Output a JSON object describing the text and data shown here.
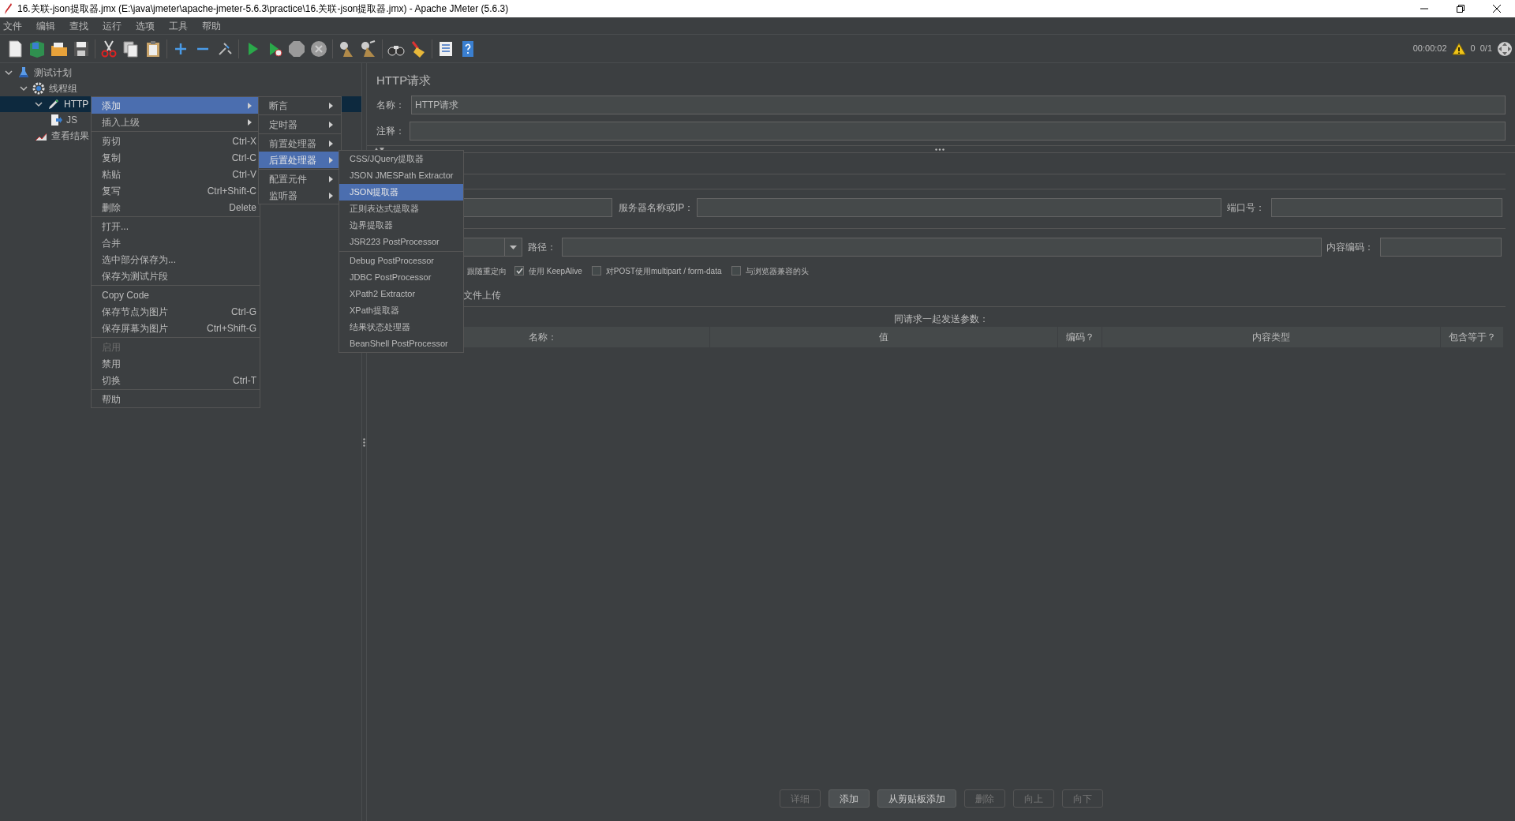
{
  "window": {
    "title": "16.关联-json提取器.jmx (E:\\java\\jmeter\\apache-jmeter-5.6.3\\practice\\16.关联-json提取器.jmx) - Apache JMeter (5.6.3)"
  },
  "menu_bar": [
    "文件",
    "编辑",
    "查找",
    "运行",
    "选项",
    "工具",
    "帮助"
  ],
  "status": {
    "elapsed": "00:00:02",
    "warnings": "0",
    "threads": "0/1"
  },
  "tree": [
    {
      "label": "测试计划",
      "kind": "test_plan",
      "selected": false,
      "expanded": true,
      "children": [
        {
          "label": "线程组",
          "kind": "thread_group",
          "selected": false,
          "expanded": true,
          "children": [
            {
              "label": "HTTP",
              "kind": "sampler",
              "selected": true,
              "expanded": true,
              "children": [
                {
                  "label": "JS",
                  "kind": "extractor",
                  "selected": false
                }
              ]
            },
            {
              "label": "查看结果",
              "kind": "listener",
              "selected": false
            }
          ]
        }
      ]
    }
  ],
  "context_menu": {
    "groups": [
      [
        {
          "label": "添加",
          "has_submenu": true,
          "selected": true,
          "disabled": false
        },
        {
          "label": "插入上级",
          "has_submenu": true,
          "selected": false,
          "disabled": false
        }
      ],
      [
        {
          "label": "剪切",
          "shortcut": "Ctrl-X",
          "has_submenu": false,
          "selected": false,
          "disabled": false
        },
        {
          "label": "复制",
          "shortcut": "Ctrl-C",
          "has_submenu": false,
          "selected": false,
          "disabled": false
        },
        {
          "label": "粘贴",
          "shortcut": "Ctrl-V",
          "has_submenu": false,
          "selected": false,
          "disabled": false
        },
        {
          "label": "复写",
          "shortcut": "Ctrl+Shift-C",
          "has_submenu": false,
          "selected": false,
          "disabled": false
        },
        {
          "label": "删除",
          "shortcut": "Delete",
          "has_submenu": false,
          "selected": false,
          "disabled": false
        }
      ],
      [
        {
          "label": "打开...",
          "has_submenu": false,
          "selected": false,
          "disabled": false
        },
        {
          "label": "合并",
          "has_submenu": false,
          "selected": false,
          "disabled": false
        },
        {
          "label": "选中部分保存为...",
          "has_submenu": false,
          "selected": false,
          "disabled": false
        },
        {
          "label": "保存为测试片段",
          "has_submenu": false,
          "selected": false,
          "disabled": false
        }
      ],
      [
        {
          "label": "Copy Code",
          "has_submenu": false,
          "selected": false,
          "disabled": false
        },
        {
          "label": "保存节点为图片",
          "shortcut": "Ctrl-G",
          "has_submenu": false,
          "selected": false,
          "disabled": false
        },
        {
          "label": "保存屏幕为图片",
          "shortcut": "Ctrl+Shift-G",
          "has_submenu": false,
          "selected": false,
          "disabled": false
        }
      ],
      [
        {
          "label": "启用",
          "has_submenu": false,
          "selected": false,
          "disabled": true
        },
        {
          "label": "禁用",
          "has_submenu": false,
          "selected": false,
          "disabled": false
        },
        {
          "label": "切换",
          "shortcut": "Ctrl-T",
          "has_submenu": false,
          "selected": false,
          "disabled": false
        }
      ],
      [
        {
          "label": "帮助",
          "has_submenu": false,
          "selected": false,
          "disabled": false
        }
      ]
    ]
  },
  "add_submenu": {
    "groups": [
      [
        {
          "label": "断言",
          "has_submenu": true,
          "selected": false
        }
      ],
      [
        {
          "label": "定时器",
          "has_submenu": true,
          "selected": false
        }
      ],
      [
        {
          "label": "前置处理器",
          "has_submenu": true,
          "selected": false
        },
        {
          "label": "后置处理器",
          "has_submenu": true,
          "selected": true
        }
      ],
      [
        {
          "label": "配置元件",
          "has_submenu": true,
          "selected": false
        },
        {
          "label": "监听器",
          "has_submenu": true,
          "selected": false
        }
      ]
    ]
  },
  "post_processor_submenu": {
    "groups": [
      [
        {
          "label": "CSS/JQuery提取器",
          "has_submenu": false,
          "selected": false
        },
        {
          "label": "JSON JMESPath Extractor",
          "has_submenu": false,
          "selected": false
        },
        {
          "label": "JSON提取器",
          "has_submenu": false,
          "selected": true
        },
        {
          "label": "正则表达式提取器",
          "has_submenu": false,
          "selected": false
        },
        {
          "label": "边界提取器",
          "has_submenu": false,
          "selected": false
        },
        {
          "label": "JSR223 PostProcessor",
          "has_submenu": false,
          "selected": false
        }
      ],
      [
        {
          "label": "Debug PostProcessor",
          "has_submenu": false,
          "selected": false
        },
        {
          "label": "JDBC PostProcessor",
          "has_submenu": false,
          "selected": false
        },
        {
          "label": "XPath2 Extractor",
          "has_submenu": false,
          "selected": false
        },
        {
          "label": "XPath提取器",
          "has_submenu": false,
          "selected": false
        },
        {
          "label": "结果状态处理器",
          "has_submenu": false,
          "selected": false
        },
        {
          "label": "BeanShell PostProcessor",
          "has_submenu": false,
          "selected": false
        }
      ]
    ]
  },
  "panel": {
    "title": "HTTP请求",
    "name": {
      "label": "名称：",
      "value": "HTTP请求"
    },
    "comments": {
      "label": "注释："
    },
    "server": {
      "label": "服务器名称或IP："
    },
    "port": {
      "label": "端口号："
    },
    "path": {
      "label": "路径："
    },
    "encoding": {
      "label": "内容编码："
    },
    "follow_redirects_label": "跟随重定向",
    "options": [
      {
        "label": "使用 KeepAlive",
        "checked": true
      },
      {
        "label": "对POST使用multipart / form-data",
        "checked": false
      },
      {
        "label": "与浏览器兼容的头",
        "checked": false
      }
    ],
    "file_upload_tab": "文件上传",
    "params": {
      "caption": "同请求一起发送参数：",
      "columns": [
        "名称：",
        "值",
        "编码？",
        "内容类型",
        "包含等于？"
      ]
    },
    "buttons": [
      {
        "label": "详细",
        "disabled": true
      },
      {
        "label": "添加",
        "disabled": false
      },
      {
        "label": "从剪贴板添加",
        "disabled": false
      },
      {
        "label": "删除",
        "disabled": true
      },
      {
        "label": "向上",
        "disabled": true
      },
      {
        "label": "向下",
        "disabled": true
      }
    ]
  }
}
